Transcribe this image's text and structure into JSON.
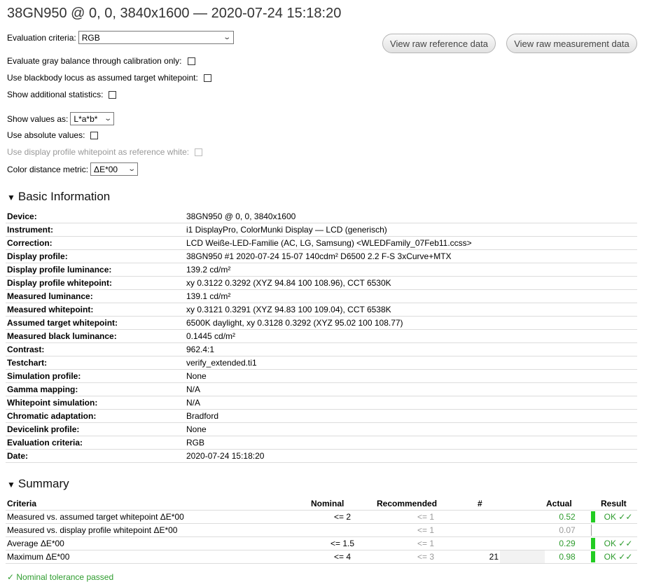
{
  "title": "38GN950 @ 0, 0, 3840x1600 — 2020-07-24 15:18:20",
  "controls": {
    "eval_criteria_label": "Evaluation criteria:",
    "eval_criteria_value": "RGB",
    "gray_balance_label": "Evaluate gray balance through calibration only:",
    "blackbody_label": "Use blackbody locus as assumed target whitepoint:",
    "additional_stats_label": "Show additional statistics:",
    "show_values_label": "Show values as:",
    "show_values_value": "L*a*b*",
    "absolute_label": "Use absolute values:",
    "display_whitepoint_label": "Use display profile whitepoint as reference white:",
    "color_distance_label": "Color distance metric:",
    "color_distance_value": "ΔE*00"
  },
  "buttons": {
    "raw_reference": "View raw reference data",
    "raw_measurement": "View raw measurement data"
  },
  "basic": {
    "heading": "Basic Information",
    "rows": [
      {
        "k": "Device:",
        "v": "38GN950 @ 0, 0, 3840x1600"
      },
      {
        "k": "Instrument:",
        "v": "i1 DisplayPro, ColorMunki Display — LCD (generisch)"
      },
      {
        "k": "Correction:",
        "v": "LCD Weiße-LED-Familie (AC, LG, Samsung) <WLEDFamily_07Feb11.ccss>"
      },
      {
        "k": "Display profile:",
        "v": "38GN950 #1 2020-07-24 15-07 140cdm² D6500 2.2 F-S 3xCurve+MTX"
      },
      {
        "k": "Display profile luminance:",
        "v": "139.2 cd/m²"
      },
      {
        "k": "Display profile whitepoint:",
        "v": "xy 0.3122 0.3292 (XYZ 94.84 100 108.96), CCT 6530K"
      },
      {
        "k": "Measured luminance:",
        "v": "139.1 cd/m²"
      },
      {
        "k": "Measured whitepoint:",
        "v": "xy 0.3121 0.3291 (XYZ 94.83 100 109.04), CCT 6538K"
      },
      {
        "k": "Assumed target whitepoint:",
        "v": "6500K daylight, xy 0.3128 0.3292 (XYZ 95.02 100 108.77)"
      },
      {
        "k": "Measured black luminance:",
        "v": "0.1445 cd/m²"
      },
      {
        "k": "Contrast:",
        "v": "962.4:1"
      },
      {
        "k": "Testchart:",
        "v": "verify_extended.ti1"
      },
      {
        "k": "Simulation profile:",
        "v": "None"
      },
      {
        "k": "Gamma mapping:",
        "v": "N/A"
      },
      {
        "k": "Whitepoint simulation:",
        "v": "N/A"
      },
      {
        "k": "Chromatic adaptation:",
        "v": "Bradford"
      },
      {
        "k": "Devicelink profile:",
        "v": "None"
      },
      {
        "k": "Evaluation criteria:",
        "v": "RGB"
      },
      {
        "k": "Date:",
        "v": "2020-07-24 15:18:20"
      }
    ]
  },
  "summary": {
    "heading": "Summary",
    "headers": {
      "criteria": "Criteria",
      "nominal": "Nominal",
      "recommended": "Recommended",
      "count": "#",
      "actual": "Actual",
      "result": "Result"
    },
    "rows": [
      {
        "criteria": "Measured vs. assumed target whitepoint ΔE*00",
        "nominal": "<= 2",
        "recommended": "<= 1",
        "count": "",
        "actual": "0.52",
        "actual_color": "green",
        "bar": true,
        "result": "OK ✓✓"
      },
      {
        "criteria": "Measured vs. display profile whitepoint ΔE*00",
        "nominal": "",
        "recommended": "<= 1",
        "count": "",
        "actual": "0.07",
        "actual_color": "gray",
        "bar": false,
        "result": ""
      },
      {
        "criteria": "Average ΔE*00",
        "nominal": "<= 1.5",
        "recommended": "<= 1",
        "count": "",
        "actual": "0.29",
        "actual_color": "green",
        "bar": true,
        "result": "OK ✓✓"
      },
      {
        "criteria": "Maximum ΔE*00",
        "nominal": "<= 4",
        "recommended": "<= 3",
        "count": "21",
        "actual": "0.98",
        "actual_color": "green",
        "bar": true,
        "result": "OK ✓✓"
      }
    ]
  },
  "footer": "✓ Nominal tolerance passed",
  "colors": {
    "ok": "#2e9c2e",
    "bar": "#22cc22"
  }
}
